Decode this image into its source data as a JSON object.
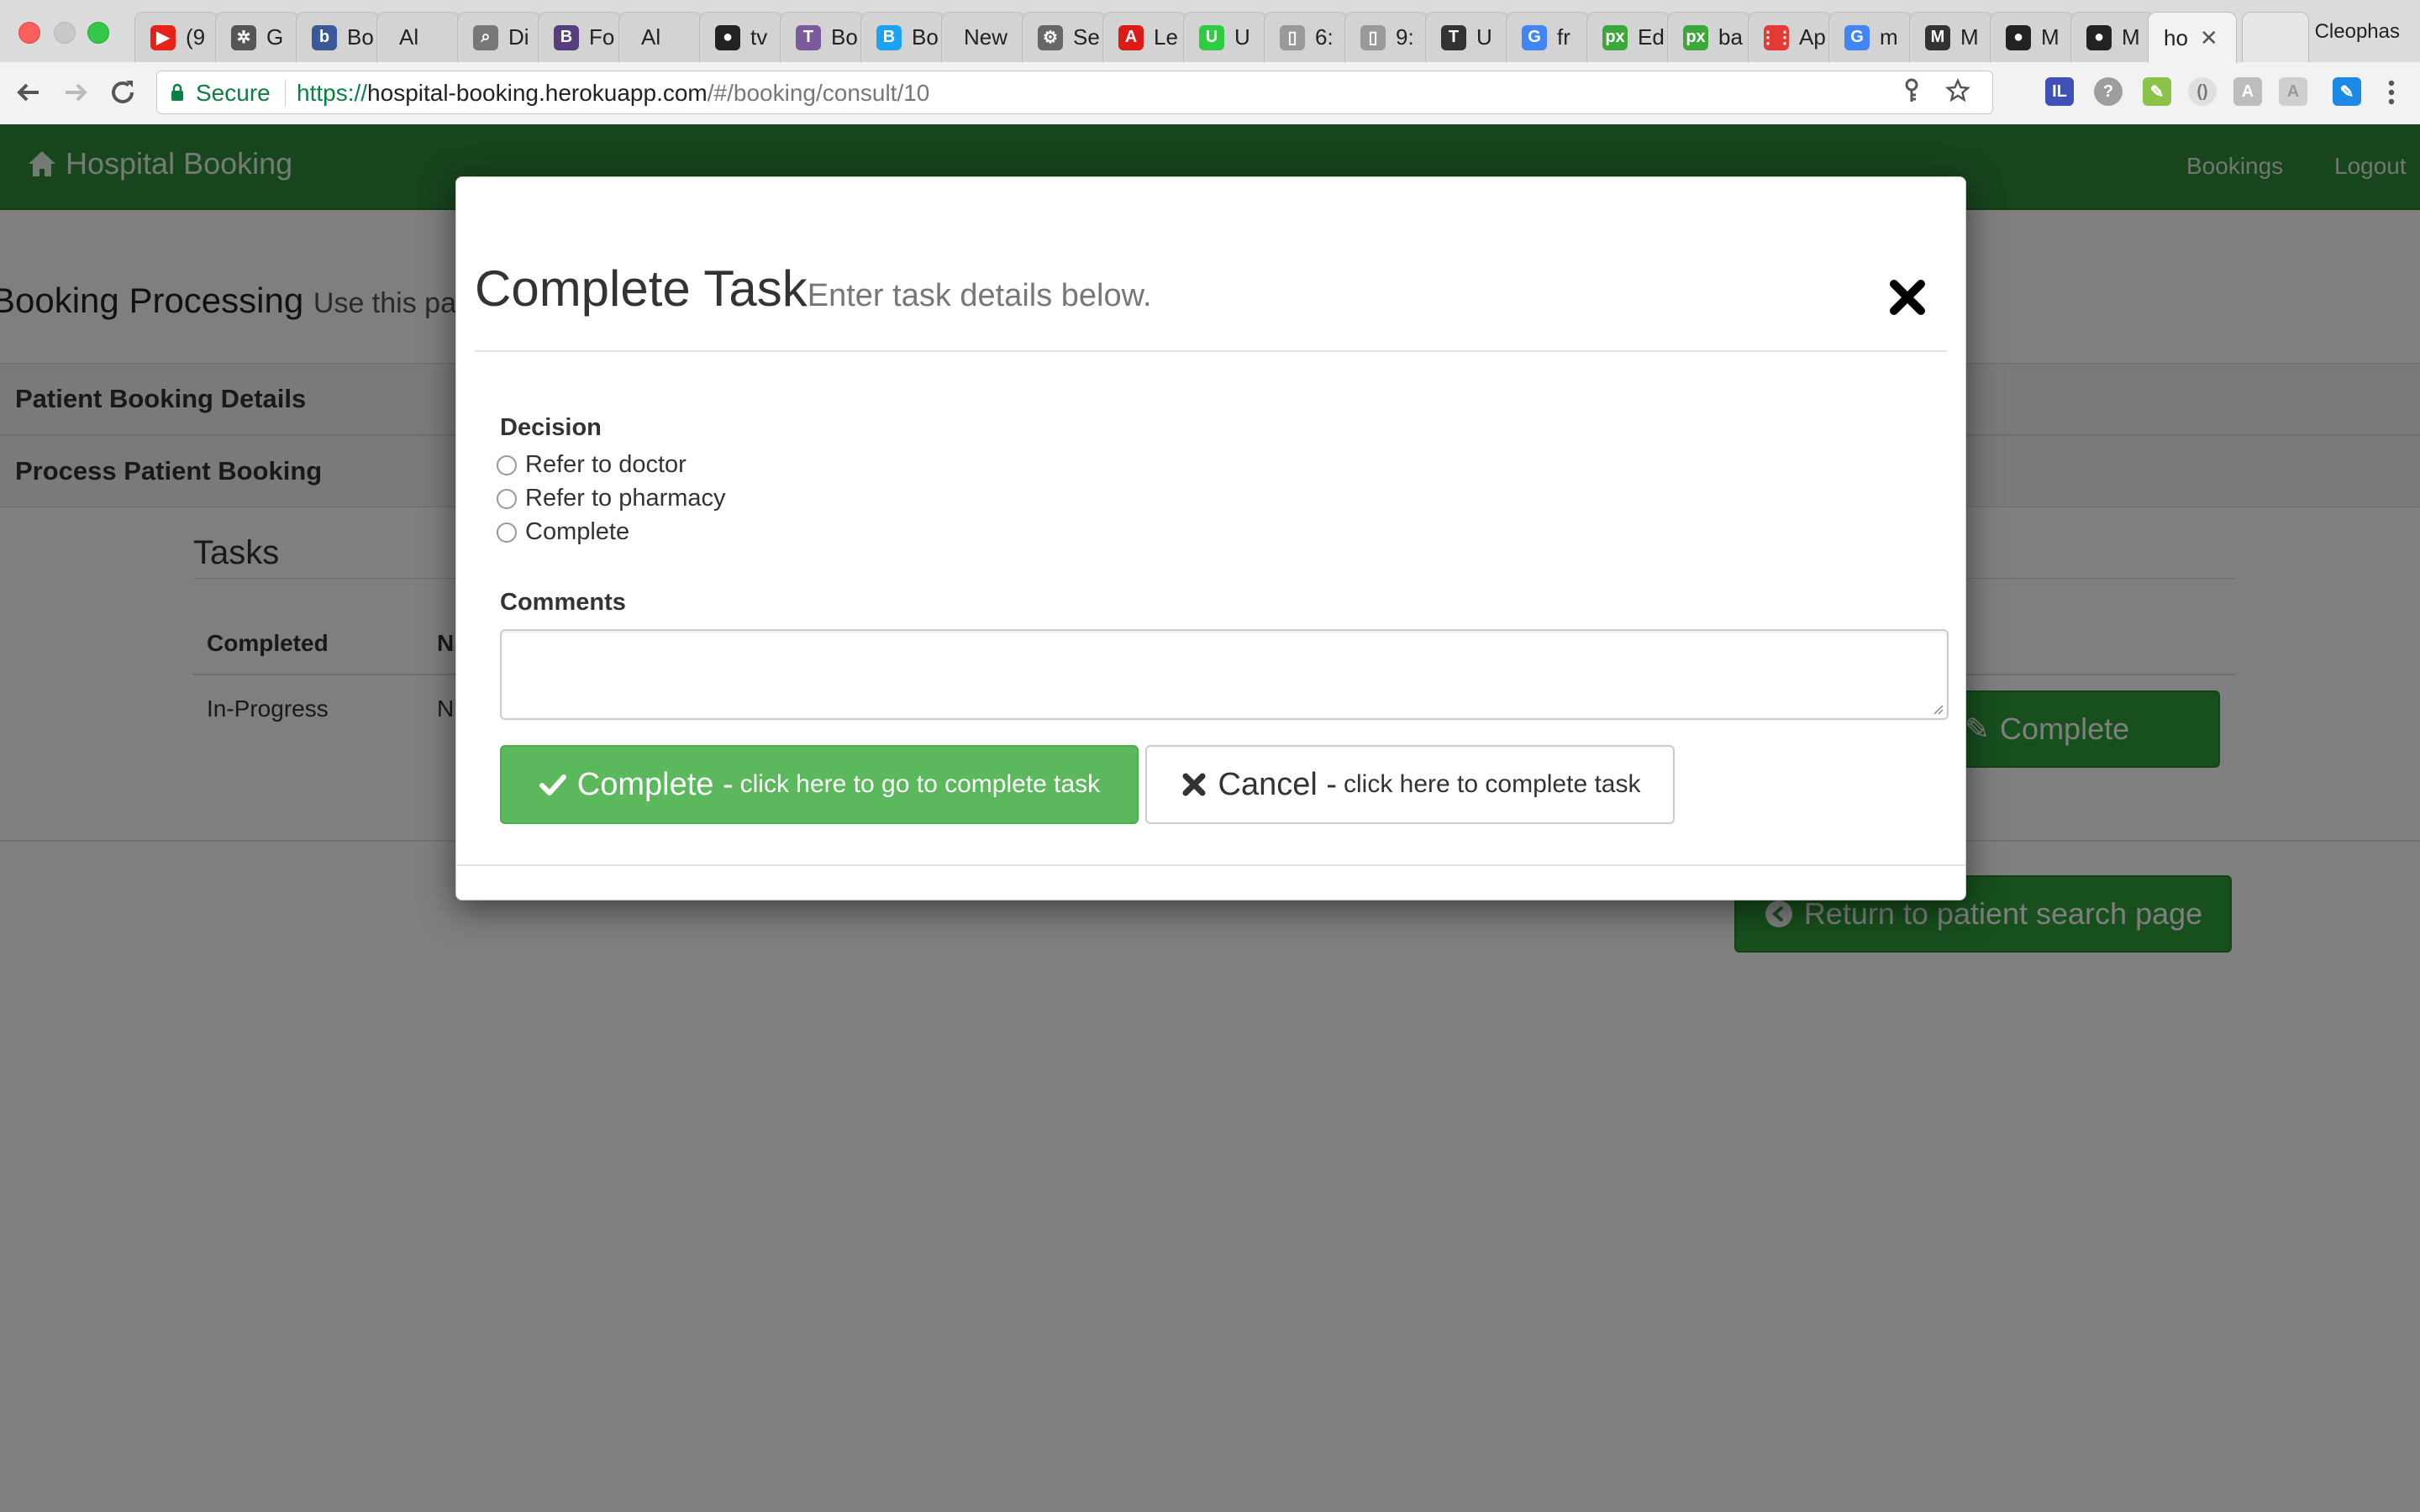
{
  "browser": {
    "tabs": [
      {
        "label": "(9",
        "favicon": "youtube-icon",
        "color": "#e62117"
      },
      {
        "label": "G",
        "favicon": "dotmark-icon",
        "color": "#555555"
      },
      {
        "label": "Bo",
        "favicon": "b-icon",
        "color": "#3b5998"
      },
      {
        "label": "Al",
        "favicon": "none",
        "color": ""
      },
      {
        "label": "Di",
        "favicon": "search-page-icon",
        "color": "#777777"
      },
      {
        "label": "Fo",
        "favicon": "bootstrap-icon",
        "color": "#563d7c"
      },
      {
        "label": "Al",
        "favicon": "none",
        "color": ""
      },
      {
        "label": "tv",
        "favicon": "github-icon",
        "color": "#222222"
      },
      {
        "label": "Bo",
        "favicon": "tt-icon",
        "color": "#7a5a9a"
      },
      {
        "label": "Bo",
        "favicon": "b-blue-icon",
        "color": "#1da1f2"
      },
      {
        "label": "New",
        "favicon": "none",
        "color": ""
      },
      {
        "label": "Se",
        "favicon": "gear-icon",
        "color": "#666666"
      },
      {
        "label": "Le",
        "favicon": "angular-icon",
        "color": "#dd1b16"
      },
      {
        "label": "U",
        "favicon": "u-icon",
        "color": "#2ecc40"
      },
      {
        "label": "6:",
        "favicon": "doc-icon",
        "color": "#999999"
      },
      {
        "label": "9:",
        "favicon": "doc-icon",
        "color": "#999999"
      },
      {
        "label": "U",
        "favicon": "tj-icon",
        "color": "#333333"
      },
      {
        "label": "fr",
        "favicon": "google-icon",
        "color": "#4285f4"
      },
      {
        "label": "Ed",
        "favicon": "px-icon",
        "color": "#3aa83a"
      },
      {
        "label": "ba",
        "favicon": "px-icon",
        "color": "#3aa83a"
      },
      {
        "label": "Ap",
        "favicon": "apps-grid-icon",
        "color": "#e53935"
      },
      {
        "label": "m",
        "favicon": "google-icon",
        "color": "#4285f4"
      },
      {
        "label": "M",
        "favicon": "markdown-icon",
        "color": "#333333"
      },
      {
        "label": "M",
        "favicon": "github-icon",
        "color": "#222222"
      },
      {
        "label": "M",
        "favicon": "github-icon",
        "color": "#222222"
      }
    ],
    "active_tab": {
      "label": "ho",
      "close": "✕"
    },
    "profile_name": "Cleophas",
    "omnibox": {
      "secure_label": "Secure",
      "url_scheme": "https://",
      "url_host": "hospital-booking.herokuapp.com",
      "url_path": "/#/booking/consult/10"
    }
  },
  "app": {
    "brand": "Hospital Booking",
    "nav": {
      "bookings": "Bookings",
      "logout": "Logout"
    },
    "heading": "Booking Processing",
    "heading_sub": "Use this pa",
    "panels": {
      "details": "Patient Booking Details",
      "process": "Process Patient Booking"
    },
    "tasks": {
      "heading": "Tasks",
      "columns": [
        "Completed",
        "N"
      ],
      "rows": [
        [
          "In-Progress",
          "N"
        ]
      ],
      "complete_button": "Complete",
      "return_button": "Return to patient search page"
    },
    "colors": {
      "navbar": "#2e8b39",
      "primary_green": "#5cb85c"
    }
  },
  "modal": {
    "title": "Complete Task",
    "subtitle": "Enter task details below.",
    "decision_label": "Decision",
    "options": [
      "Refer to doctor",
      "Refer to pharmacy",
      "Complete"
    ],
    "comments_label": "Comments",
    "comments_value": "",
    "complete_button": {
      "main": "Complete -",
      "sub": "click here to go to complete task"
    },
    "cancel_button": {
      "main": "Cancel -",
      "sub": "click here to complete task"
    }
  }
}
